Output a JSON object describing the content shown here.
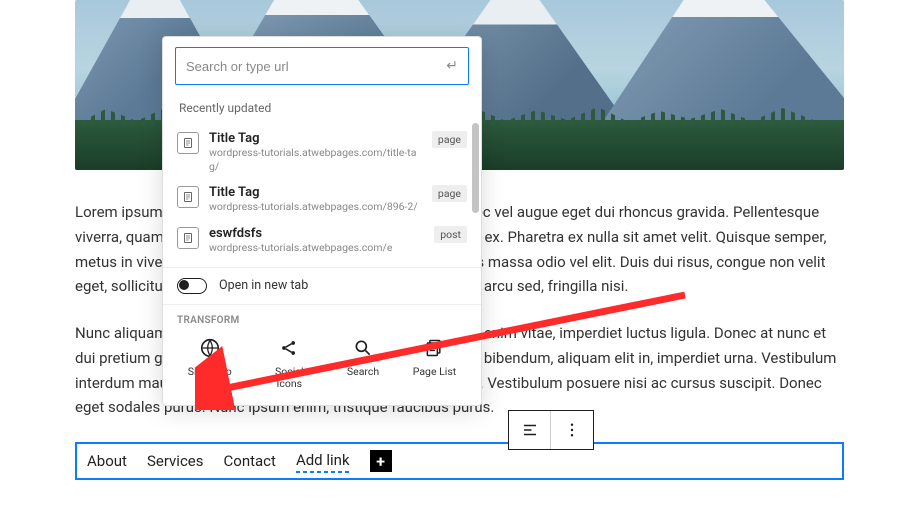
{
  "search": {
    "placeholder": "Search or type url"
  },
  "sections": {
    "recent": "Recently updated"
  },
  "results": [
    {
      "title": "Title Tag",
      "url": "wordpress-tutorials.atwebpages.com/title-tag/",
      "type": "page"
    },
    {
      "title": "Title Tag",
      "url": "wordpress-tutorials.atwebpages.com/896-2/",
      "type": "page"
    },
    {
      "title": "eswfdsfs",
      "url": "wordpress-tutorials.atwebpages.com/e",
      "type": "post"
    }
  ],
  "newtab": {
    "label": "Open in new tab"
  },
  "transform": {
    "heading": "TRANSFORM",
    "items": [
      {
        "label": "Site Logo"
      },
      {
        "label": "Social Icons"
      },
      {
        "label": "Search"
      },
      {
        "label": "Page List"
      }
    ]
  },
  "nav": {
    "items": [
      "About",
      "Services",
      "Contact"
    ],
    "add": "Add link"
  },
  "content": {
    "p1": "Lorem ipsum dolor sit amet, consectetur adipiscing elit. Donec vel augue eget dui rhoncus gravida. Pellentesque viverra, quam vel malesuada pellentesque, velit nunc posuere ex. Pharetra ex nulla sit amet velit. Quisque semper, metus in viverra lacinia, mauris tortor gravida nunc. Nulla quis massa odio vel elit. Duis dui risus, congue non velit eget, sollicitudin elementum quam. Quisque semper, metus a arcu sed, fringilla nisi.",
    "p2": "Nunc aliquam semper tellus. Nunc ipsum enim, tristique eget enim vitae, imperdiet luctus ligula. Donec at nunc et dui pretium gravida. Sed at purus et leo pulvinar pellentesque bibendum, aliquam elit in, imperdiet urna. Vestibulum interdum mauris eu tristique tincidunt. Vestibulum commodo. Vestibulum posuere nisi ac cursus suscipit. Donec eget sodales purus. Nunc ipsum enim, tristique faucibus purus."
  }
}
